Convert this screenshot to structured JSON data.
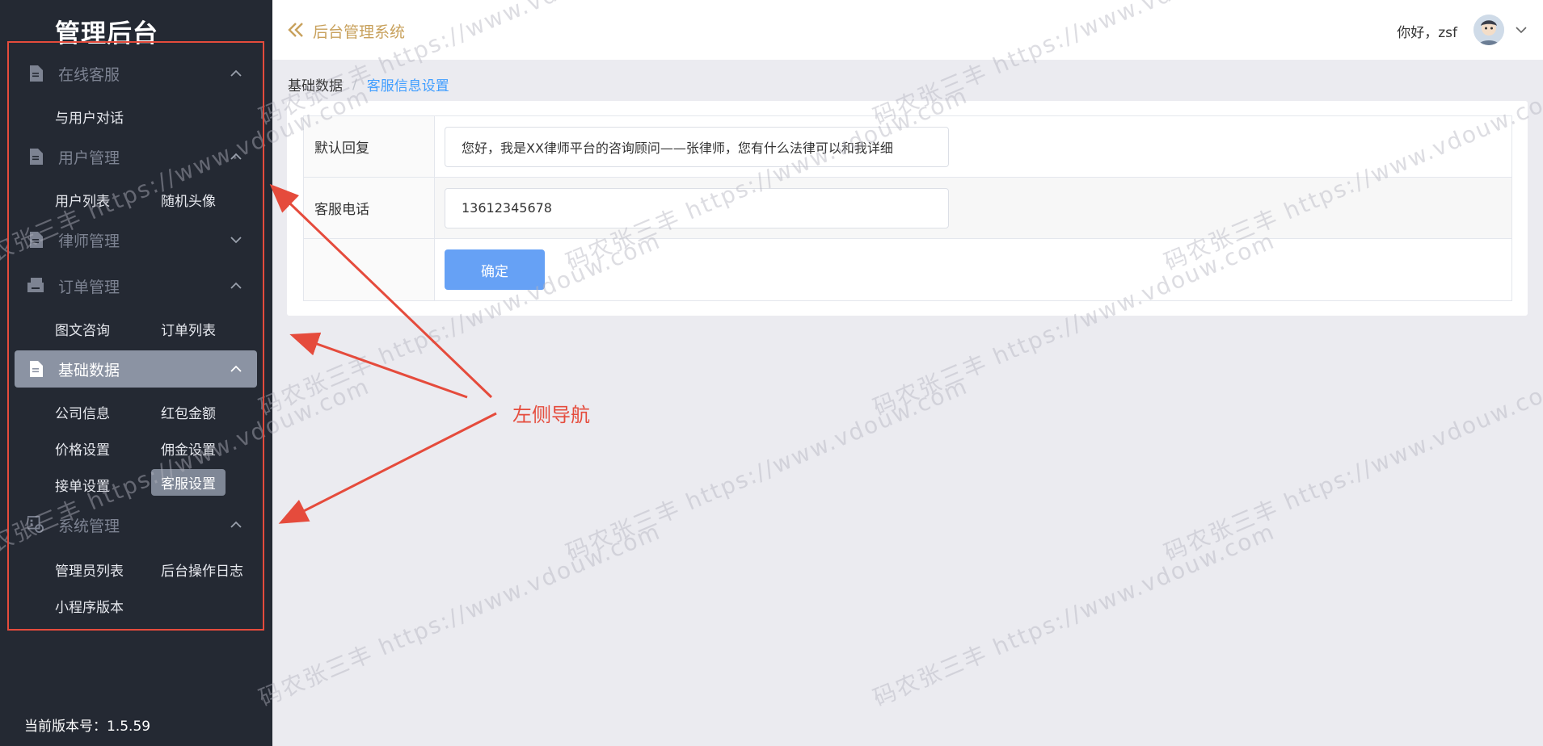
{
  "sidebar": {
    "logo": "管理后台",
    "groups": [
      {
        "label": "在线客服",
        "icon": "document-icon",
        "expanded": true
      },
      {
        "label": "用户管理",
        "icon": "document-icon",
        "expanded": true
      },
      {
        "label": "律师管理",
        "icon": "document-icon",
        "expanded": false
      },
      {
        "label": "订单管理",
        "icon": "printer-icon",
        "expanded": true
      },
      {
        "label": "基础数据",
        "icon": "document-icon",
        "expanded": true,
        "active": true
      },
      {
        "label": "系统管理",
        "icon": "system-settings-icon",
        "expanded": true
      }
    ],
    "items": {
      "chat": "与用户对话",
      "user_list": "用户列表",
      "random_avatar": "随机头像",
      "consult": "图文咨询",
      "order_list": "订单列表",
      "company_info": "公司信息",
      "red_packet": "红包金额",
      "price_settings": "价格设置",
      "commission": "佣金设置",
      "order_settings": "接单设置",
      "service_settings": "客服设置",
      "admin_list": "管理员列表",
      "op_log": "后台操作日志",
      "mini_version": "小程序版本"
    },
    "version": "当前版本号：1.5.59"
  },
  "header": {
    "title": "后台管理系统",
    "greeting": "你好，zsf"
  },
  "breadcrumb": {
    "parent": "基础数据",
    "separator": "/",
    "current": "客服信息设置"
  },
  "form": {
    "default_reply_label": "默认回复",
    "default_reply_value": "您好，我是XX律师平台的咨询顾问——张律师，您有什么法律可以和我详细",
    "phone_label": "客服电话",
    "phone_value": "13612345678",
    "submit_label": "确定"
  },
  "annotation": {
    "label": "左侧导航",
    "color": "#e54b3c"
  },
  "watermark": {
    "text": "码农张三丰 https://www.vdouw.com"
  },
  "colors": {
    "sidebar_bg": "#242933",
    "accent": "#409eff",
    "header_title": "#c8a15c",
    "button": "#66a1f5"
  }
}
